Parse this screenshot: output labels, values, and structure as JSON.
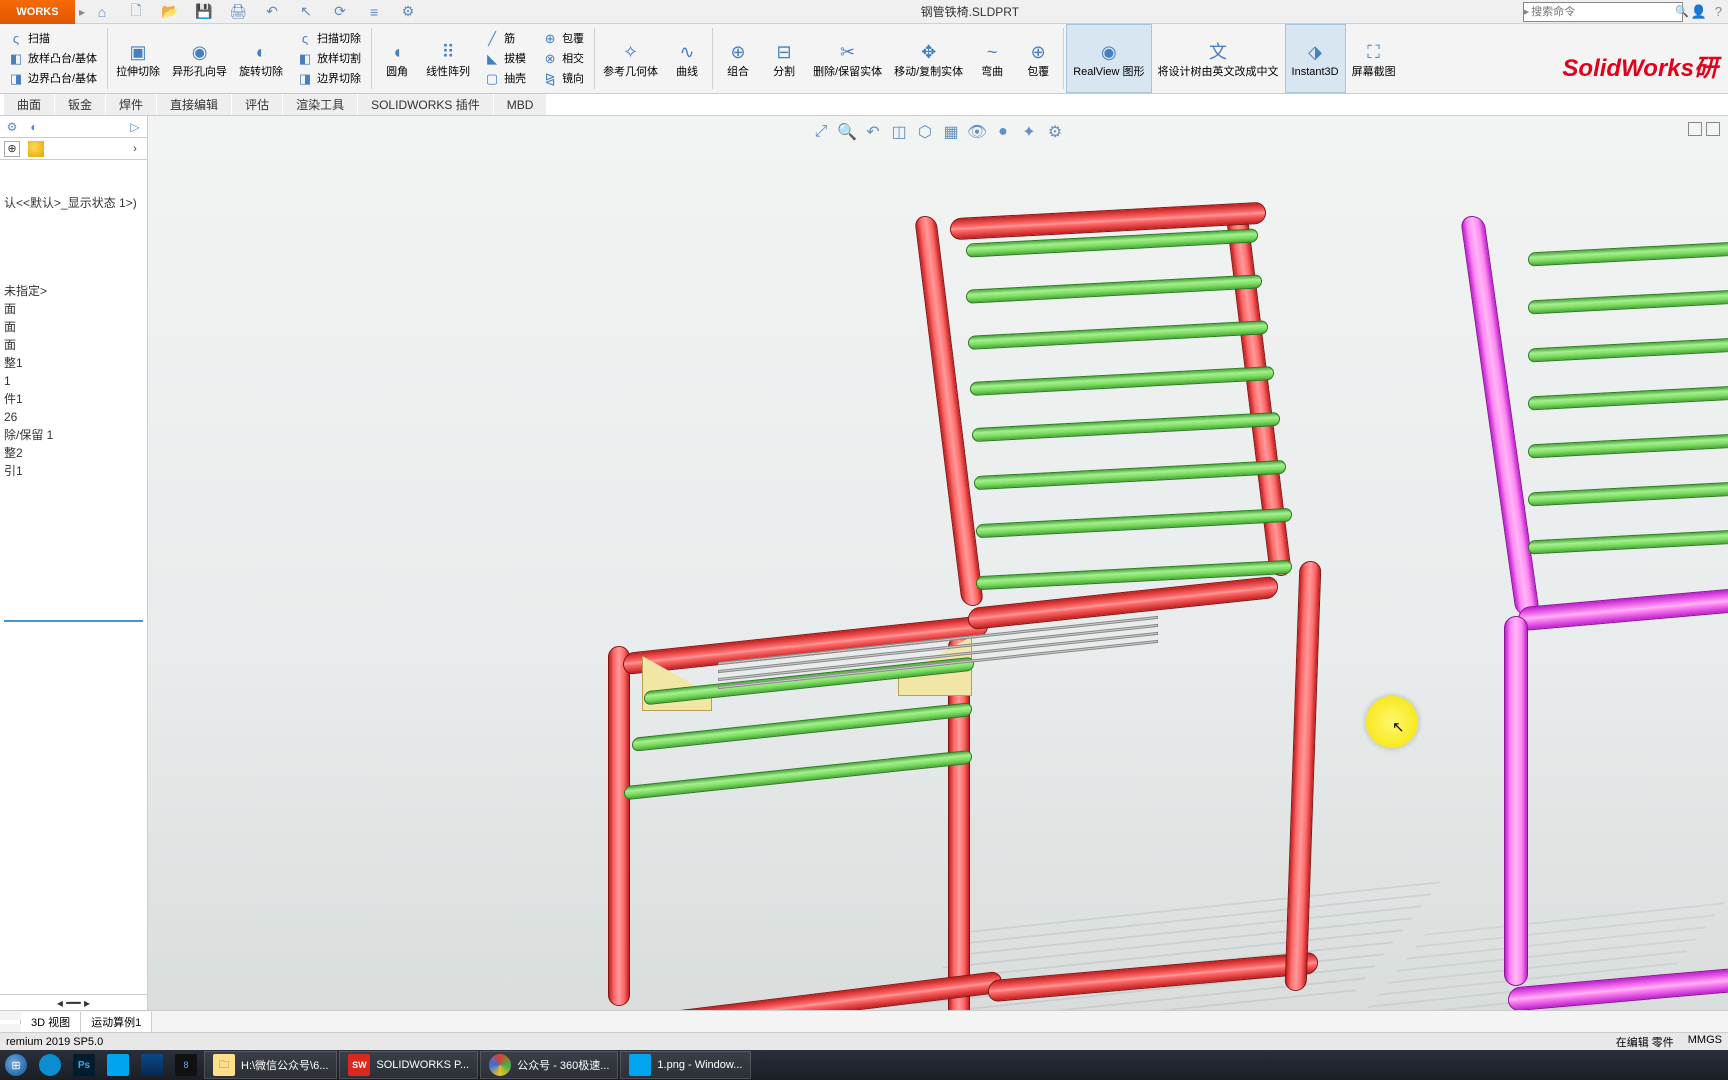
{
  "title": {
    "file": "钢管铁椅.SLDPRT",
    "watermark": "SolidWorks研"
  },
  "logo": "WORKS",
  "search": {
    "placeholder": "搜索命令"
  },
  "qat": {
    "home": "⌂",
    "new": "🗋",
    "open": "📂",
    "save": "💾",
    "print": "🖨",
    "undo": "↶",
    "select": "↖",
    "rebuild": "⟳",
    "opts": "≡",
    "gear": "⚙"
  },
  "ribbon_slim": {
    "a1": "扫描",
    "a2": "放样凸台/基体",
    "a3": "边界凸台/基体",
    "b": "拉伸切除",
    "c": "异形孔向导",
    "d": "旋转切除",
    "e1": "扫描切除",
    "e2": "放样切割",
    "e3": "边界切除"
  },
  "ribbon_big": [
    {
      "label": "圆角"
    },
    {
      "label": "线性阵列"
    },
    {
      "label": "筋"
    },
    {
      "label": "拔模"
    },
    {
      "label": "抽壳"
    },
    {
      "label": "包覆"
    },
    {
      "label": "相交"
    },
    {
      "label": "镜向"
    },
    {
      "label": "参考几何体"
    },
    {
      "label": "曲线"
    },
    {
      "label": "组合"
    },
    {
      "label": "分割"
    },
    {
      "label": "删除/保留实体"
    },
    {
      "label": "移动/复制实体"
    },
    {
      "label": "弯曲"
    },
    {
      "label": "包覆"
    },
    {
      "label": "RealView 图形",
      "active": true
    },
    {
      "label": "将设计树由英文改成中文"
    },
    {
      "label": "Instant3D",
      "active": true
    },
    {
      "label": "屏幕截图"
    }
  ],
  "tabs": [
    "曲面",
    "钣金",
    "焊件",
    "直接编辑",
    "评估",
    "渲染工具",
    "SOLIDWORKS 插件",
    "MBD"
  ],
  "tree_state": "认<<默认>_显示状态 1>)",
  "tree_items": [
    "未指定>",
    "面",
    "面",
    "面",
    "整1",
    "1",
    "件1",
    "26",
    "除/保留 1",
    "整2",
    "引1"
  ],
  "btabs": [
    "",
    "3D 视图",
    "运动算例1"
  ],
  "status": {
    "left": "remium 2019 SP5.0",
    "mode": "在编辑 零件",
    "units": "MMGS"
  },
  "taskbar": {
    "folder": "H:\\微信公众号\\6...",
    "sw": "SOLIDWORKS P...",
    "browser": "公众号 - 360极速...",
    "img": "1.png - Window..."
  }
}
